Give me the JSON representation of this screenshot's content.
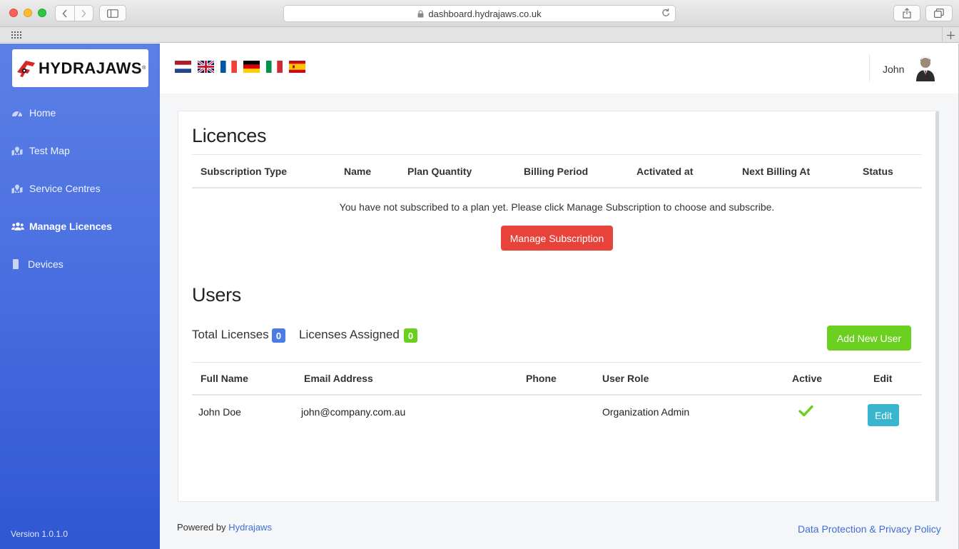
{
  "browser": {
    "url": "dashboard.hydrajaws.co.uk"
  },
  "brand": {
    "logo_text": "HYDRAJAWS",
    "logo_mark": "®",
    "logo_color": "#d7262a",
    "sidebar_gradient_top": "#5b80e6",
    "sidebar_gradient_bottom": "#2f57d2"
  },
  "sidebar": {
    "items": [
      {
        "label": "Home",
        "icon": "dashboard-gauge-icon"
      },
      {
        "label": "Test Map",
        "icon": "map-icon"
      },
      {
        "label": "Service Centres",
        "icon": "map-icon"
      },
      {
        "label": "Manage Licences",
        "icon": "users-icon",
        "active": true
      },
      {
        "label": "Devices",
        "icon": "mobile-device-icon"
      }
    ],
    "version": "Version 1.0.1.0"
  },
  "topbar": {
    "languages": [
      "Dutch",
      "English",
      "French",
      "German",
      "Italian",
      "Spanish"
    ],
    "user_name": "John"
  },
  "licences": {
    "title": "Licences",
    "columns": [
      "Subscription Type",
      "Name",
      "Plan Quantity",
      "Billing Period",
      "Activated at",
      "Next Billing At",
      "Status"
    ],
    "empty_message": "You have not subscribed to a plan yet. Please click Manage Subscription to choose and subscribe.",
    "manage_button": "Manage Subscription"
  },
  "users": {
    "title": "Users",
    "total_licenses_label": "Total Licenses",
    "total_licenses_value": "0",
    "assigned_label": "Licenses Assigned",
    "assigned_value": "0",
    "add_button": "Add New User",
    "columns": [
      "Full Name",
      "Email Address",
      "Phone",
      "User Role",
      "Active",
      "Edit"
    ],
    "rows": [
      {
        "full_name": "John Doe",
        "email": "john@company.com.au",
        "phone": "",
        "role": "Organization Admin",
        "active": true,
        "edit_label": "Edit"
      }
    ]
  },
  "footer": {
    "powered_prefix": "Powered by ",
    "powered_link": "Hydrajaws",
    "privacy_link": "Data Protection & Privacy Policy"
  },
  "colors": {
    "danger": "#e8433b",
    "success": "#6bcf1f",
    "info": "#3ab5cf",
    "primary_badge": "#4c7ce3",
    "link": "#3e6ed6"
  }
}
